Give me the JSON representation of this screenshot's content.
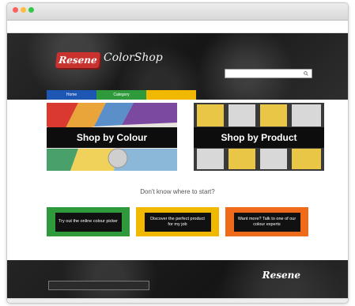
{
  "window": {
    "title": "",
    "toolbar_text": ""
  },
  "utility": {
    "welcome": "",
    "links": []
  },
  "brand": {
    "logo_text": "Resene",
    "shop_name": "ColorShop",
    "shop_sub": "",
    "accent_red": "#c8322f"
  },
  "search": {
    "placeholder": "",
    "icon": "search-icon"
  },
  "nav": {
    "tabs": [
      {
        "label": "Home",
        "color": "#1e56b3"
      },
      {
        "label": "Category",
        "color": "#2f9a3c"
      },
      {
        "label": "",
        "color": "#f1b800"
      }
    ]
  },
  "hero": {
    "colour_label": "Shop by Colour",
    "product_label": "Shop by Product"
  },
  "prompt": "Don't know where to start?",
  "ctas": [
    {
      "label": "Try out the online colour picker",
      "color": "#2f9a3c"
    },
    {
      "label": "Discover the perfect product for my job",
      "color": "#f1b800"
    },
    {
      "label": "Want more? Talk to one of our colour experts",
      "color": "#ef6a1b"
    }
  ],
  "footer": {
    "text": "",
    "button_label": "",
    "logo_text": "Resene",
    "logo_sub": ""
  },
  "status": {
    "url": ""
  }
}
